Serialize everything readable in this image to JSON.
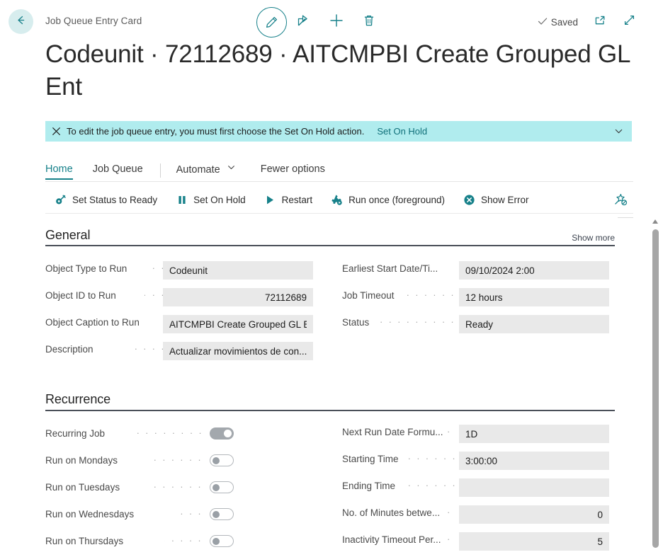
{
  "topbar": {
    "back_icon": "arrow-left-icon",
    "breadcrumb": "Job Queue Entry Card",
    "commands": [
      {
        "name": "edit-button",
        "icon": "pencil-icon"
      },
      {
        "name": "share-button",
        "icon": "share-icon"
      },
      {
        "name": "new-button",
        "icon": "plus-icon"
      },
      {
        "name": "delete-button",
        "icon": "trash-icon"
      }
    ],
    "saved_label": "Saved",
    "saved_icon": "check-icon",
    "open_in_new_window_icon": "open-new-window-icon",
    "fullscreen_icon": "expand-arrows-icon"
  },
  "page_title": "Codeunit · 72112689 · AITCMPBI Create Grouped GL Ent",
  "notification": {
    "close_icon": "close-icon",
    "message": "To edit the job queue entry, you must first choose the Set On Hold action.",
    "action_label": "Set On Hold",
    "expand_icon": "chevron-down-icon",
    "background": "#b0ecee"
  },
  "tabs": [
    {
      "label": "Home",
      "active": true
    },
    {
      "label": "Job Queue",
      "active": false
    },
    {
      "label": "Automate",
      "active": false,
      "has_chevron": true
    },
    {
      "label": "Fewer options",
      "active": false
    }
  ],
  "ribbon": {
    "actions": [
      {
        "label": "Set Status to Ready",
        "icon": "set-ready-icon"
      },
      {
        "label": "Set On Hold",
        "icon": "pause-icon"
      },
      {
        "label": "Restart",
        "icon": "play-icon"
      },
      {
        "label": "Run once (foreground)",
        "icon": "run-once-icon"
      },
      {
        "label": "Show Error",
        "icon": "error-circle-icon"
      }
    ],
    "pin_icon": "unpin-icon",
    "accent": "#17818a"
  },
  "general": {
    "heading": "General",
    "show_more": "Show more",
    "left_fields": [
      {
        "label": "Object Type to Run",
        "value": "Codeunit",
        "align": "left"
      },
      {
        "label": "Object ID to Run",
        "value": "72112689",
        "align": "right"
      },
      {
        "label": "Object Caption to Run",
        "value": "AITCMPBI Create Grouped GL E...",
        "align": "left"
      },
      {
        "label": "Description",
        "value": "Actualizar movimientos de con...",
        "align": "left"
      }
    ],
    "right_fields": [
      {
        "label": "Earliest Start Date/Ti...",
        "value": "09/10/2024 2:00",
        "align": "left"
      },
      {
        "label": "Job Timeout",
        "value": "12 hours",
        "align": "left"
      },
      {
        "label": "Status",
        "value": "Ready",
        "align": "left"
      }
    ]
  },
  "recurrence": {
    "heading": "Recurrence",
    "toggles": [
      {
        "label": "Recurring Job",
        "on": true
      },
      {
        "label": "Run on Mondays",
        "on": false
      },
      {
        "label": "Run on Tuesdays",
        "on": false
      },
      {
        "label": "Run on Wednesdays",
        "on": false
      },
      {
        "label": "Run on Thursdays",
        "on": false
      }
    ],
    "right_fields": [
      {
        "label": "Next Run Date Formu...",
        "value": "1D",
        "align": "left"
      },
      {
        "label": "Starting Time",
        "value": "3:00:00",
        "align": "left"
      },
      {
        "label": "Ending Time",
        "value": "",
        "align": "left"
      },
      {
        "label": "No. of Minutes betwe...",
        "value": "0",
        "align": "right"
      },
      {
        "label": "Inactivity Timeout Per...",
        "value": "5",
        "align": "right"
      }
    ]
  },
  "scrollbar": {
    "name": "vertical-scrollbar",
    "up_arrow_icon": "caret-up-icon"
  }
}
